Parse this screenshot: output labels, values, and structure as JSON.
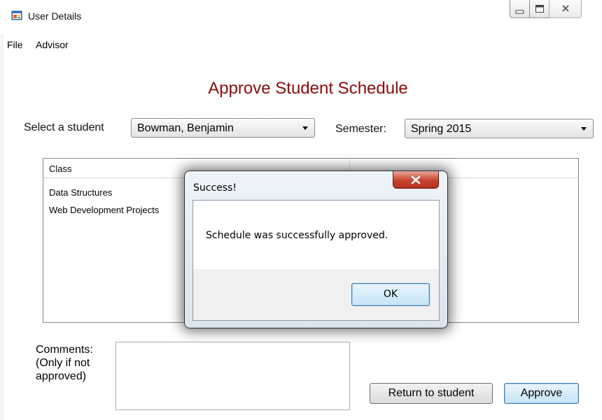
{
  "window": {
    "title": "User Details",
    "icon": "app-window-icon"
  },
  "menu": {
    "items": [
      {
        "label": "File"
      },
      {
        "label": "Advisor"
      }
    ]
  },
  "form": {
    "title": "Approve Student Schedule",
    "student_label": "Select a student",
    "student_value": "Bowman, Benjamin",
    "semester_label": "Semester:",
    "semester_value": "Spring 2015",
    "title_color": "#8b0b0b"
  },
  "class_list": {
    "column_header": "Class",
    "rows": [
      "Data Structures",
      "Web Development Projects"
    ]
  },
  "comments": {
    "label_line1": "Comments:",
    "label_line2": "(Only if not",
    "label_line3": "approved)",
    "value": ""
  },
  "buttons": {
    "return_label": "Return to student",
    "approve_label": "Approve"
  },
  "dialog": {
    "title": "Success!",
    "message": "Schedule was successfully approved.",
    "ok_label": "OK"
  }
}
